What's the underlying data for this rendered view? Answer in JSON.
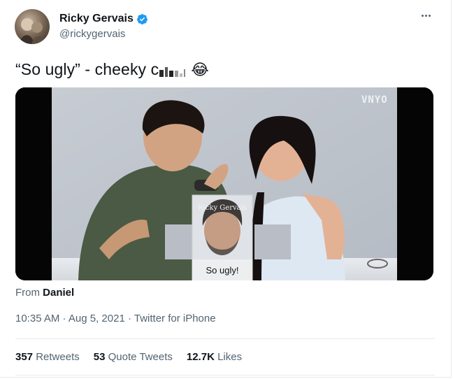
{
  "author": {
    "display_name": "Ricky Gervais",
    "handle": "@rickygervais",
    "verified": true
  },
  "tweet": {
    "text": "“So ugly” - cheeky c",
    "emoji": "😂"
  },
  "media": {
    "watermark": "VNYO",
    "inset_caption_top": "Ricky Gervais",
    "inset_caption_bottom": "So ugly!"
  },
  "attribution": {
    "prefix": "From",
    "name": "Daniel"
  },
  "meta": {
    "timestamp": "10:35 AM · Aug 5, 2021",
    "separator": " · ",
    "source": "Twitter for iPhone"
  },
  "stats": {
    "retweets_count": "357",
    "retweets_label": "Retweets",
    "quotes_count": "53",
    "quotes_label": "Quote Tweets",
    "likes_count": "12.7K",
    "likes_label": "Likes"
  },
  "colors": {
    "verified_blue": "#1d9bf0",
    "secondary_text": "#536471",
    "primary_text": "#0f1419"
  }
}
